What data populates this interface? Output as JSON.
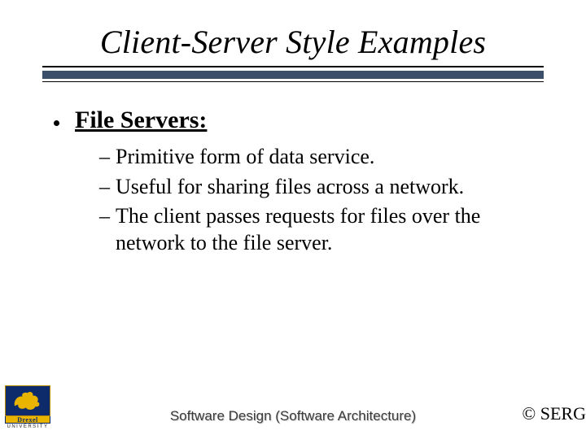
{
  "title": "Client-Server Style Examples",
  "bullets": {
    "l1": {
      "label": "File Servers:"
    },
    "sub": [
      "Primitive form of data service.",
      "Useful for sharing files across a network.",
      "The client passes requests for files over the network to the file server."
    ]
  },
  "footer": {
    "center": "Software Design (Software Architecture)",
    "right": "© SERG",
    "logo_text": "Drexel",
    "logo_sub": "UNIVERSITY"
  }
}
